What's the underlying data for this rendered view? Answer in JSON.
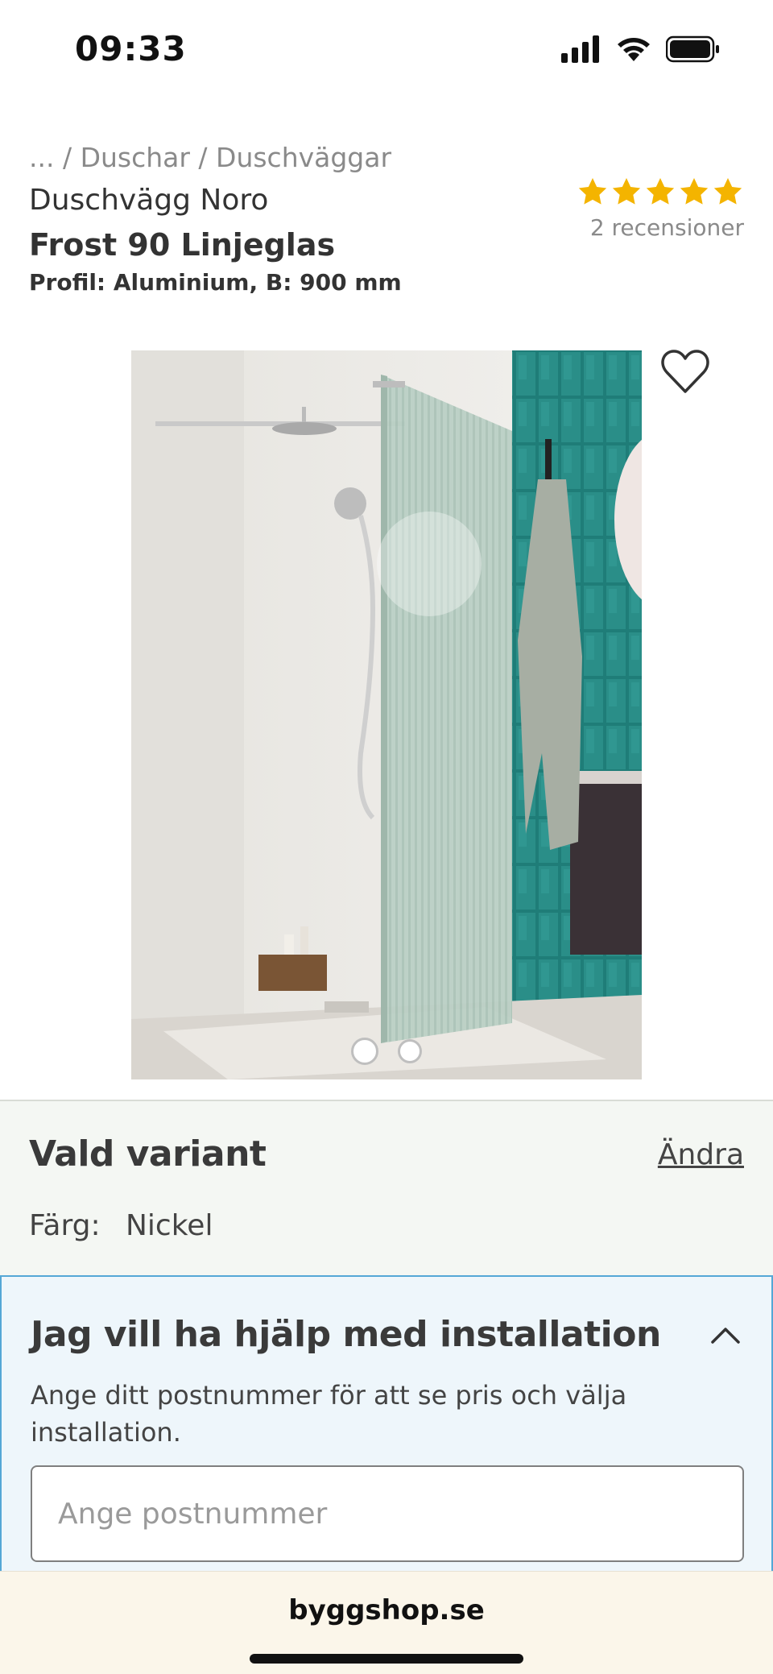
{
  "status_bar": {
    "time": "09:33",
    "icons": [
      "cellular-signal-icon",
      "wifi-icon",
      "battery-icon"
    ]
  },
  "breadcrumb": "... / Duschar / Duschväggar",
  "product": {
    "name": "Duschvägg Noro",
    "variant": "Frost 90 Linjeglas",
    "spec": "Profil: Aluminium, B: 900 mm",
    "rating": 5,
    "reviews": "2 recensioner",
    "star_color": "#f4b400",
    "favorite_icon": "heart-outline-icon"
  },
  "gallery": {
    "image_count": 2,
    "active_index": 0,
    "image_description": "Product photo of a frosted ribbed glass shower wall in a bathroom with green tiles"
  },
  "selected_variant": {
    "title": "Vald variant",
    "change_link": "Ändra",
    "color_label": "Färg:",
    "color_value": "Nickel"
  },
  "installation": {
    "title": "Jag vill ha hjälp med installation",
    "description": "Ange ditt postnummer för att se pris och välja installation.",
    "postcode_placeholder": "Ange postnummer",
    "accent_color": "#55a7d6"
  },
  "browser": {
    "domain": "byggshop.se"
  }
}
